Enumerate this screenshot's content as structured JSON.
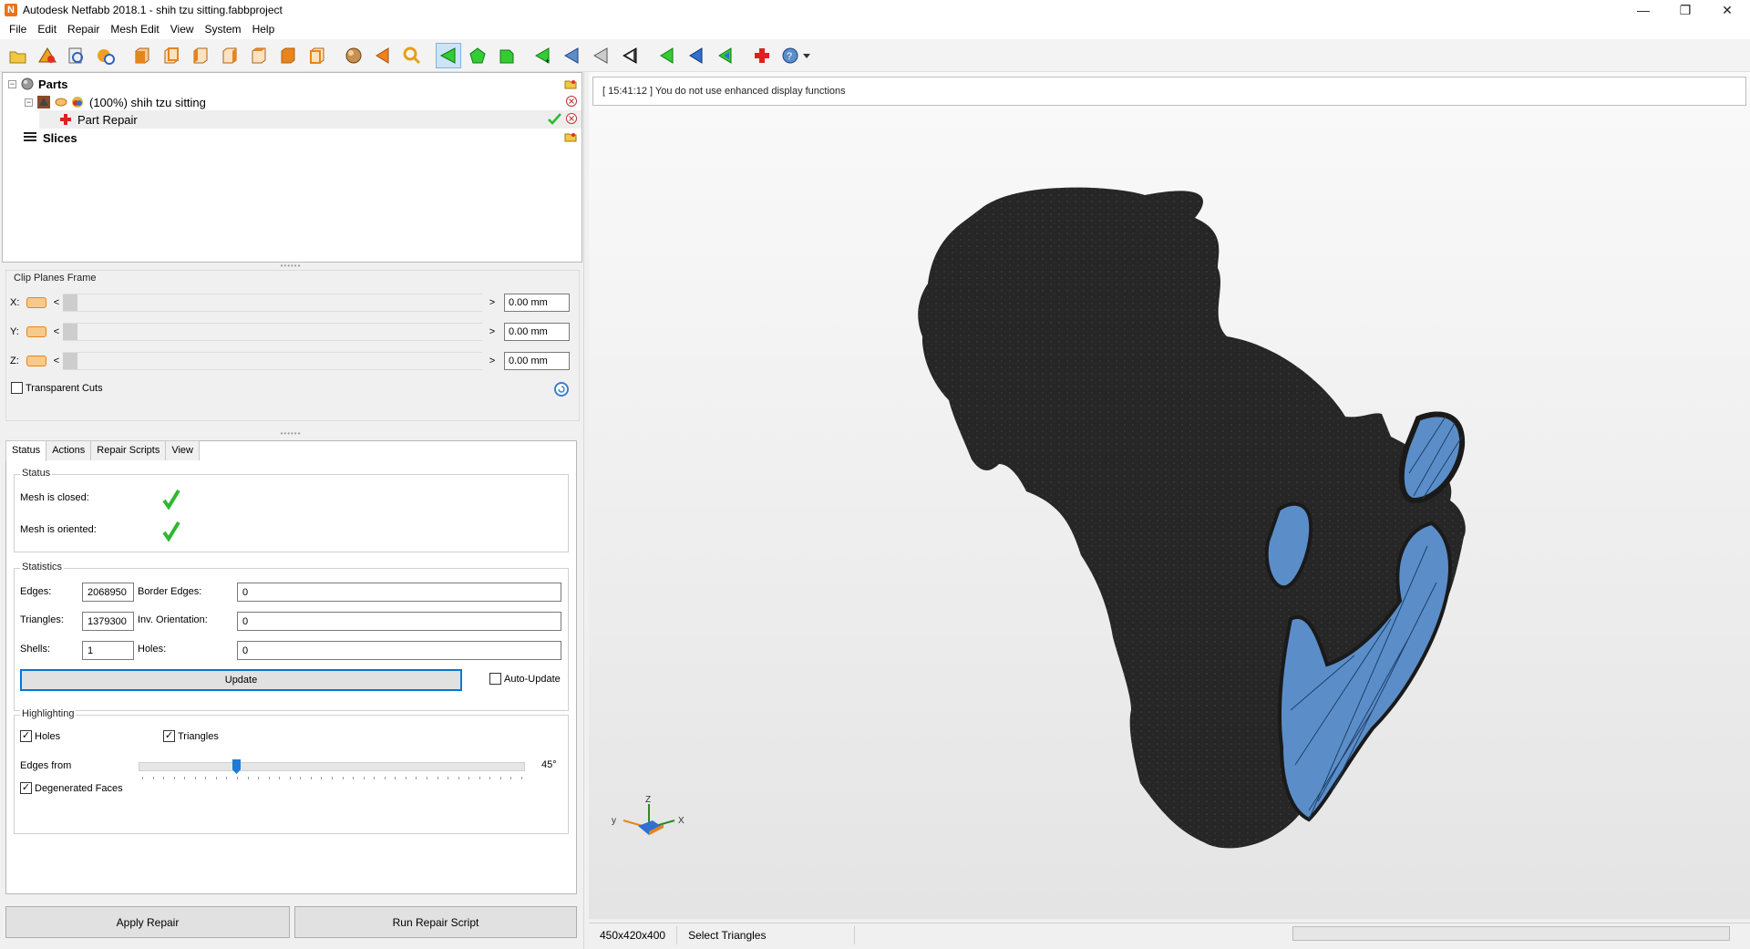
{
  "window": {
    "title": "Autodesk Netfabb 2018.1 - shih tzu sitting.fabbproject",
    "logo_letter": "N"
  },
  "menu": [
    "File",
    "Edit",
    "Repair",
    "Mesh Edit",
    "View",
    "System",
    "Help"
  ],
  "tree": {
    "parts_label": "Parts",
    "part_label": "(100%) shih tzu sitting",
    "repair_label": "Part Repair",
    "slices_label": "Slices"
  },
  "clip": {
    "title": "Clip Planes Frame",
    "rows": [
      {
        "axis": "X:",
        "value": "0.00 mm"
      },
      {
        "axis": "Y:",
        "value": "0.00 mm"
      },
      {
        "axis": "Z:",
        "value": "0.00 mm"
      }
    ],
    "transparent_label": "Transparent Cuts",
    "transparent_checked": false
  },
  "tabs": [
    "Status",
    "Actions",
    "Repair Scripts",
    "View"
  ],
  "status": {
    "group_title": "Status",
    "mesh_closed_label": "Mesh is closed:",
    "mesh_oriented_label": "Mesh is oriented:"
  },
  "statistics": {
    "group_title": "Statistics",
    "edges_label": "Edges:",
    "edges_value": "2068950",
    "border_edges_label": "Border Edges:",
    "border_edges_value": "0",
    "triangles_label": "Triangles:",
    "triangles_value": "1379300",
    "inv_orientation_label": "Inv. Orientation:",
    "inv_orientation_value": "0",
    "shells_label": "Shells:",
    "shells_value": "1",
    "holes_label": "Holes:",
    "holes_value": "0",
    "update_label": "Update",
    "auto_update_label": "Auto-Update"
  },
  "highlighting": {
    "group_title": "Highlighting",
    "holes_label": "Holes",
    "triangles_label": "Triangles",
    "edges_from_label": "Edges from",
    "edges_from_value": "45°",
    "edges_from_fraction": 0.25,
    "degenerated_label": "Degenerated Faces"
  },
  "bottom_buttons": {
    "apply_repair": "Apply Repair",
    "run_script": "Run Repair Script"
  },
  "viewport": {
    "log_message": "[ 15:41:12 ] You do not use enhanced display functions",
    "axes": {
      "z": "Z",
      "y": "y",
      "x": "X"
    }
  },
  "statusbar": {
    "dimensions": "450x420x400",
    "mode": "Select Triangles"
  },
  "colors": {
    "mesh": "#262626",
    "hole_fill": "#5b8ec9",
    "check_green": "#2db82d",
    "accent_orange": "#e8841c"
  }
}
